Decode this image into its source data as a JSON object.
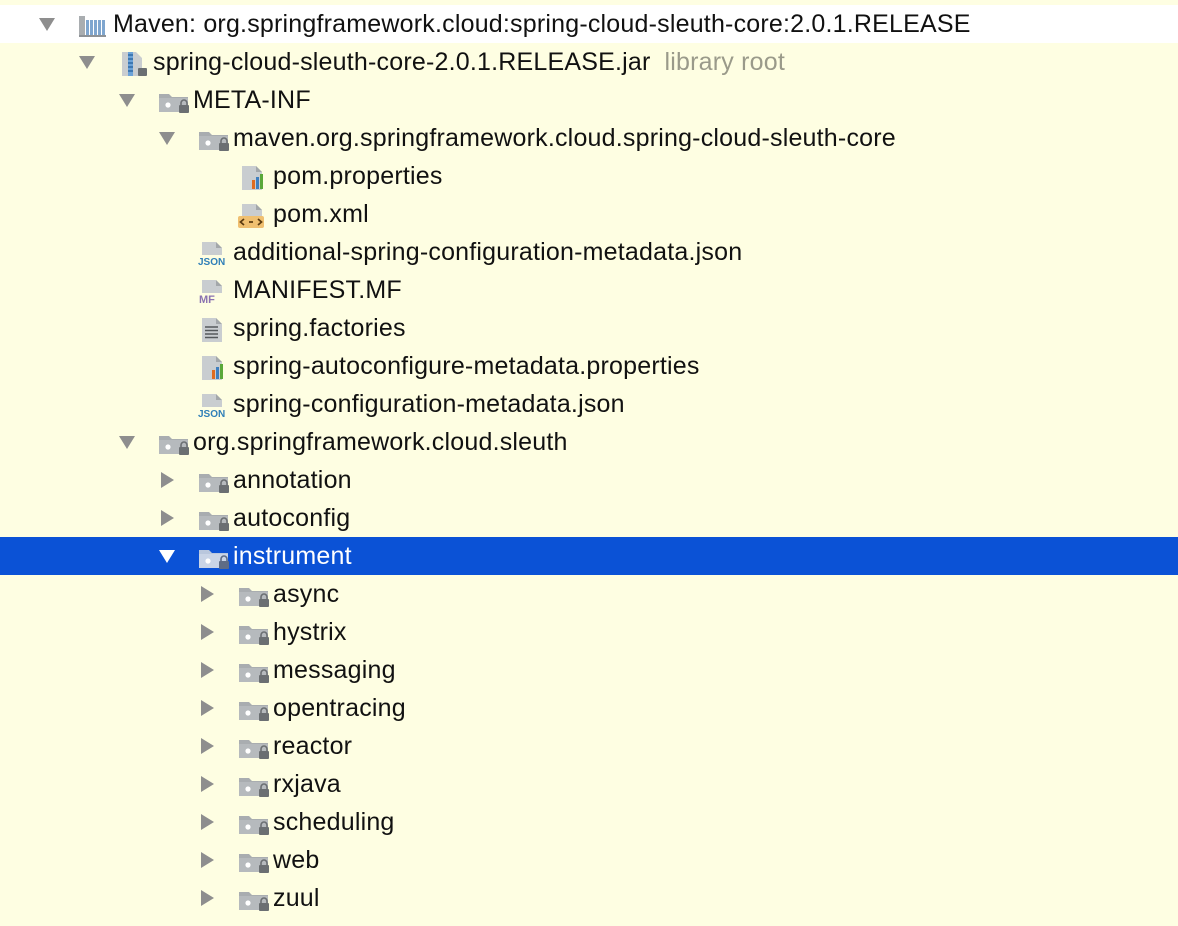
{
  "tree": {
    "root": {
      "label": "Maven: org.springframework.cloud:spring-cloud-sleuth-core:2.0.1.RELEASE",
      "icon": "library-icon",
      "expanded": true
    },
    "jar": {
      "label": "spring-cloud-sleuth-core-2.0.1.RELEASE.jar",
      "secondary": "library root",
      "icon": "jar-icon",
      "expanded": true
    },
    "meta_inf": {
      "label": "META-INF",
      "icon": "package-folder-icon",
      "expanded": true
    },
    "maven_pkg": {
      "label": "maven.org.springframework.cloud.spring-cloud-sleuth-core",
      "icon": "package-folder-icon",
      "expanded": true
    },
    "pom_properties": {
      "label": "pom.properties",
      "icon": "properties-file-icon"
    },
    "pom_xml": {
      "label": "pom.xml",
      "icon": "xml-file-icon"
    },
    "additional_json": {
      "label": "additional-spring-configuration-metadata.json",
      "icon": "json-file-icon"
    },
    "manifest": {
      "label": "MANIFEST.MF",
      "icon": "manifest-file-icon"
    },
    "factories": {
      "label": "spring.factories",
      "icon": "text-file-icon"
    },
    "autoconfigure_properties": {
      "label": "spring-autoconfigure-metadata.properties",
      "icon": "properties-file-icon"
    },
    "config_json": {
      "label": "spring-configuration-metadata.json",
      "icon": "json-file-icon"
    },
    "sleuth_pkg": {
      "label": "org.springframework.cloud.sleuth",
      "icon": "package-folder-icon",
      "expanded": true
    },
    "annotation": {
      "label": "annotation",
      "icon": "package-folder-icon",
      "expanded": false
    },
    "autoconfig": {
      "label": "autoconfig",
      "icon": "package-folder-icon",
      "expanded": false
    },
    "instrument": {
      "label": "instrument",
      "icon": "package-folder-icon",
      "expanded": true,
      "selected": true
    },
    "async": {
      "label": "async",
      "icon": "package-folder-icon",
      "expanded": false
    },
    "hystrix": {
      "label": "hystrix",
      "icon": "package-folder-icon",
      "expanded": false
    },
    "messaging": {
      "label": "messaging",
      "icon": "package-folder-icon",
      "expanded": false
    },
    "opentracing": {
      "label": "opentracing",
      "icon": "package-folder-icon",
      "expanded": false
    },
    "reactor": {
      "label": "reactor",
      "icon": "package-folder-icon",
      "expanded": false
    },
    "rxjava": {
      "label": "rxjava",
      "icon": "package-folder-icon",
      "expanded": false
    },
    "scheduling": {
      "label": "scheduling",
      "icon": "package-folder-icon",
      "expanded": false
    },
    "web": {
      "label": "web",
      "icon": "package-folder-icon",
      "expanded": false
    },
    "zuul": {
      "label": "zuul",
      "icon": "package-folder-icon",
      "expanded": false
    }
  },
  "colors": {
    "background": "#fefee2",
    "selection": "#0b52d6",
    "root_row": "#ffffff",
    "text": "#111111",
    "secondary_text": "#9a9a8a"
  }
}
